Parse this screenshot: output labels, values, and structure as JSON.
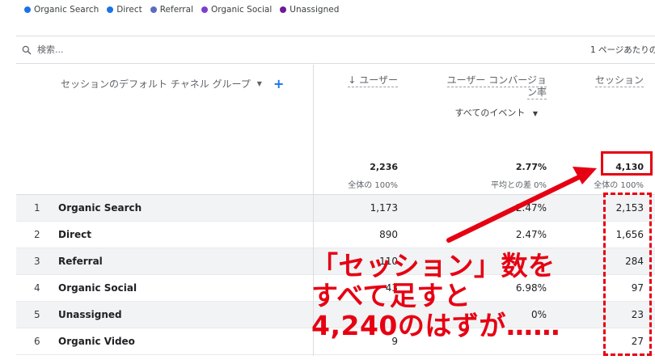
{
  "legend": [
    {
      "label": "Organic Search",
      "color": "#1a73e8"
    },
    {
      "label": "Direct",
      "color": "#1a73e8"
    },
    {
      "label": "Referral",
      "color": "#5c6bc0"
    },
    {
      "label": "Organic Social",
      "color": "#7b3fd0"
    },
    {
      "label": "Unassigned",
      "color": "#6a1b9a"
    }
  ],
  "search": {
    "placeholder": "検索..."
  },
  "rows_per_page_label": "1 ページあたりの",
  "table": {
    "dimension_header": "セッションのデフォルト チャネル グループ",
    "col_users": "↓ ユーザー",
    "col_conversion_line1": "ユーザー コンバージョ",
    "col_conversion_line2": "ン率",
    "col_sessions": "セッション",
    "event_select": "すべてのイベント",
    "totals": {
      "users": "2,236",
      "users_sub": "全体の 100%",
      "conversion": "2.77%",
      "conversion_sub": "平均との差 0%",
      "sessions": "4,130",
      "sessions_sub": "全体の 100%"
    },
    "rows": [
      {
        "idx": "1",
        "name": "Organic Search",
        "users": "1,173",
        "conv": "2.47%",
        "sessions": "2,153"
      },
      {
        "idx": "2",
        "name": "Direct",
        "users": "890",
        "conv": "2.47%",
        "sessions": "1,656"
      },
      {
        "idx": "3",
        "name": "Referral",
        "users": "110",
        "conv": "",
        "sessions": "284"
      },
      {
        "idx": "4",
        "name": "Organic Social",
        "users": "43",
        "conv": "6.98%",
        "sessions": "97"
      },
      {
        "idx": "5",
        "name": "Unassigned",
        "users": "",
        "conv": "0%",
        "sessions": "23"
      },
      {
        "idx": "6",
        "name": "Organic Video",
        "users": "9",
        "conv": "",
        "sessions": "27"
      }
    ]
  },
  "annotation": {
    "line1": "「セッション」数を",
    "line2": "すべて足すと",
    "line3": "4,240のはずが……",
    "color": "#e60012"
  }
}
